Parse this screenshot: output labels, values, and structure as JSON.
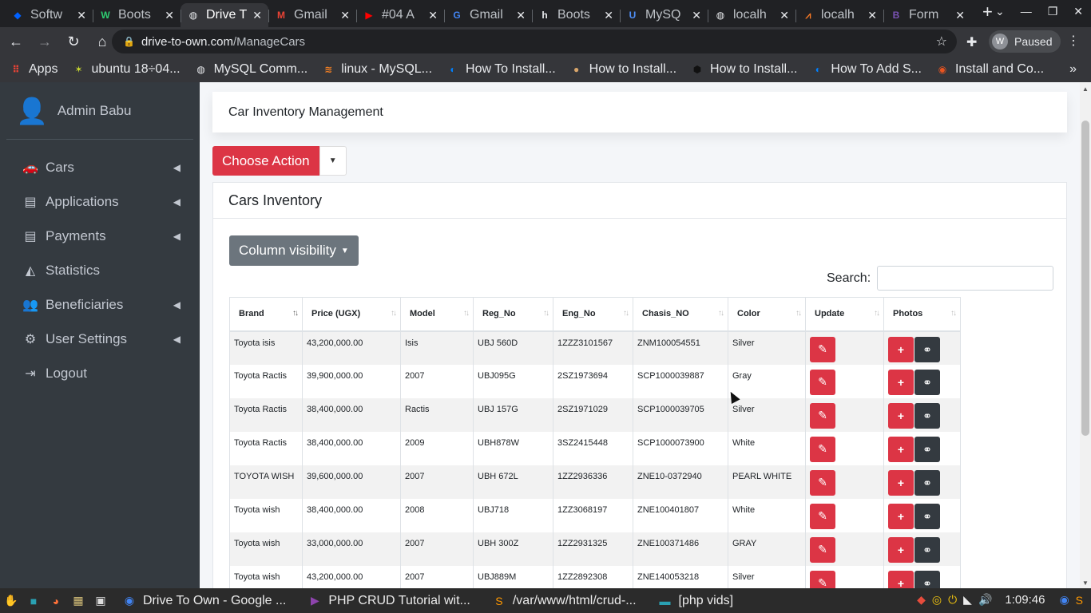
{
  "browser": {
    "tabs": [
      {
        "title": "Softw",
        "icon": "dropbox-icon",
        "color": "#0061ff",
        "glyph": "◆",
        "active": false
      },
      {
        "title": "Boots",
        "icon": "w-icon",
        "color": "#2ecc71",
        "glyph": "W",
        "active": false
      },
      {
        "title": "Drive T",
        "icon": "globe-icon",
        "color": "#e8eaed",
        "glyph": "◍",
        "active": true
      },
      {
        "title": "Gmail",
        "icon": "gmail-icon",
        "color": "#ea4335",
        "glyph": "M",
        "active": false
      },
      {
        "title": "#04 A",
        "icon": "youtube-icon",
        "color": "#ff0000",
        "glyph": "▶",
        "active": false
      },
      {
        "title": "Gmail",
        "icon": "google-icon",
        "color": "#4285f4",
        "glyph": "G",
        "active": false
      },
      {
        "title": "Boots",
        "icon": "hashnode-icon",
        "color": "#e8eaed",
        "glyph": "h",
        "active": false
      },
      {
        "title": "MySQ",
        "icon": "mysql-icon",
        "color": "#4f8ff7",
        "glyph": "U",
        "active": false
      },
      {
        "title": "localh",
        "icon": "globe-icon",
        "color": "#e8eaed",
        "glyph": "◍",
        "active": false
      },
      {
        "title": "localh",
        "icon": "xampp-icon",
        "color": "#fb7a24",
        "glyph": "⩘",
        "active": false
      },
      {
        "title": "Form",
        "icon": "bootstrap-icon",
        "color": "#7952b3",
        "glyph": "B",
        "active": false
      }
    ],
    "url_host": "drive-to-own.com",
    "url_path": "/ManageCars",
    "profile_status": "Paused",
    "profile_initial": "W",
    "bookmarks": [
      {
        "label": "Apps",
        "icon": "apps-grid-icon",
        "color": "#ea4335",
        "glyph": "⠿"
      },
      {
        "label": "ubuntu 18÷04...",
        "icon": "ubuntu-bookmark-icon",
        "color": "#c7d630",
        "glyph": "✶"
      },
      {
        "label": "MySQL Comm...",
        "icon": "globe-icon",
        "color": "#e8eaed",
        "glyph": "◍"
      },
      {
        "label": "linux - MySQL...",
        "icon": "stackoverflow-icon",
        "color": "#f48024",
        "glyph": "≋"
      },
      {
        "label": "How To Install...",
        "icon": "digitalocean-icon",
        "color": "#0080ff",
        "glyph": "◐"
      },
      {
        "label": "How to Install...",
        "icon": "site-icon",
        "color": "#d9a66b",
        "glyph": "●"
      },
      {
        "label": "How to Install...",
        "icon": "hexagon-icon",
        "color": "#111111",
        "glyph": "⬢"
      },
      {
        "label": "How To Add S...",
        "icon": "digitalocean-icon",
        "color": "#0080ff",
        "glyph": "◐"
      },
      {
        "label": "Install and Co...",
        "icon": "ubuntu-icon",
        "color": "#e95420",
        "glyph": "◉"
      }
    ]
  },
  "sidebar": {
    "user_name": "Admin Babu",
    "items": [
      {
        "label": "Cars",
        "icon": "car-icon",
        "glyph": "🚗",
        "caret": true
      },
      {
        "label": "Applications",
        "icon": "book-icon",
        "glyph": "▤",
        "caret": true
      },
      {
        "label": "Payments",
        "icon": "book-icon",
        "glyph": "▤",
        "caret": true
      },
      {
        "label": "Statistics",
        "icon": "chart-area-icon",
        "glyph": "◭",
        "caret": false
      },
      {
        "label": "Beneficiaries",
        "icon": "users-icon",
        "glyph": "👥",
        "caret": true
      },
      {
        "label": "User Settings",
        "icon": "gear-icon",
        "glyph": "⚙",
        "caret": true
      },
      {
        "label": "Logout",
        "icon": "sign-out-icon",
        "glyph": "⇥",
        "caret": false
      }
    ]
  },
  "page": {
    "header_title": "Car Inventory Management",
    "choose_action_label": "Choose Action",
    "card_title": "Cars Inventory",
    "column_visibility_label": "Column visibility",
    "search_label": "Search:",
    "search_value": ""
  },
  "table": {
    "columns": [
      "Brand",
      "Price (UGX)",
      "Model",
      "Reg_No",
      "Eng_No",
      "Chasis_NO",
      "Color",
      "Update",
      "Photos"
    ],
    "rows": [
      {
        "brand": "Toyota isis",
        "price": "43,200,000.00",
        "model": "Isis",
        "reg": "UBJ 560D",
        "eng": "1ZZZ3101567",
        "chasis": "ZNM100054551",
        "color": "Silver"
      },
      {
        "brand": "Toyota Ractis",
        "price": "39,900,000.00",
        "model": "2007",
        "reg": "UBJ095G",
        "eng": "2SZ1973694",
        "chasis": "SCP1000039887",
        "color": "Gray"
      },
      {
        "brand": "Toyota Ractis",
        "price": "38,400,000.00",
        "model": "Ractis",
        "reg": "UBJ 157G",
        "eng": "2SZ1971029",
        "chasis": "SCP1000039705",
        "color": "Silver"
      },
      {
        "brand": "Toyota Ractis",
        "price": "38,400,000.00",
        "model": "2009",
        "reg": "UBH878W",
        "eng": "3SZ2415448",
        "chasis": "SCP1000073900",
        "color": "White"
      },
      {
        "brand": "TOYOTA WISH",
        "price": "39,600,000.00",
        "model": "2007",
        "reg": "UBH 672L",
        "eng": "1ZZ2936336",
        "chasis": "ZNE10-0372940",
        "color": "PEARL WHITE"
      },
      {
        "brand": "Toyota wish",
        "price": "38,400,000.00",
        "model": "2008",
        "reg": "UBJ718",
        "eng": "1ZZ3068197",
        "chasis": "ZNE100401807",
        "color": "White"
      },
      {
        "brand": "Toyota wish",
        "price": "33,000,000.00",
        "model": "2007",
        "reg": "UBH 300Z",
        "eng": "1ZZ2931325",
        "chasis": "ZNE100371486",
        "color": "GRAY"
      },
      {
        "brand": "Toyota wish",
        "price": "43,200,000.00",
        "model": "2007",
        "reg": "UBJ889M",
        "eng": "1ZZ2892308",
        "chasis": "ZNE140053218",
        "color": "Silver"
      }
    ]
  },
  "taskbar": {
    "tasks": [
      {
        "label": "Drive To Own - Google ...",
        "icon": "chrome-icon",
        "color": "#4285f4",
        "glyph": "◉"
      },
      {
        "label": "PHP CRUD Tutorial wit...",
        "icon": "media-player-icon",
        "color": "#8e44ad",
        "glyph": "▶"
      },
      {
        "label": "/var/www/html/crud-...",
        "icon": "sublime-icon",
        "color": "#ff9800",
        "glyph": "S"
      },
      {
        "label": "[php vids]",
        "icon": "folder-icon",
        "color": "#2aa1b3",
        "glyph": "▬"
      }
    ],
    "clock": "1:09:46"
  },
  "colors": {
    "danger": "#dc3545",
    "dark": "#343a40",
    "secondary": "#6c757d",
    "sidebar_bg": "#343a40"
  }
}
